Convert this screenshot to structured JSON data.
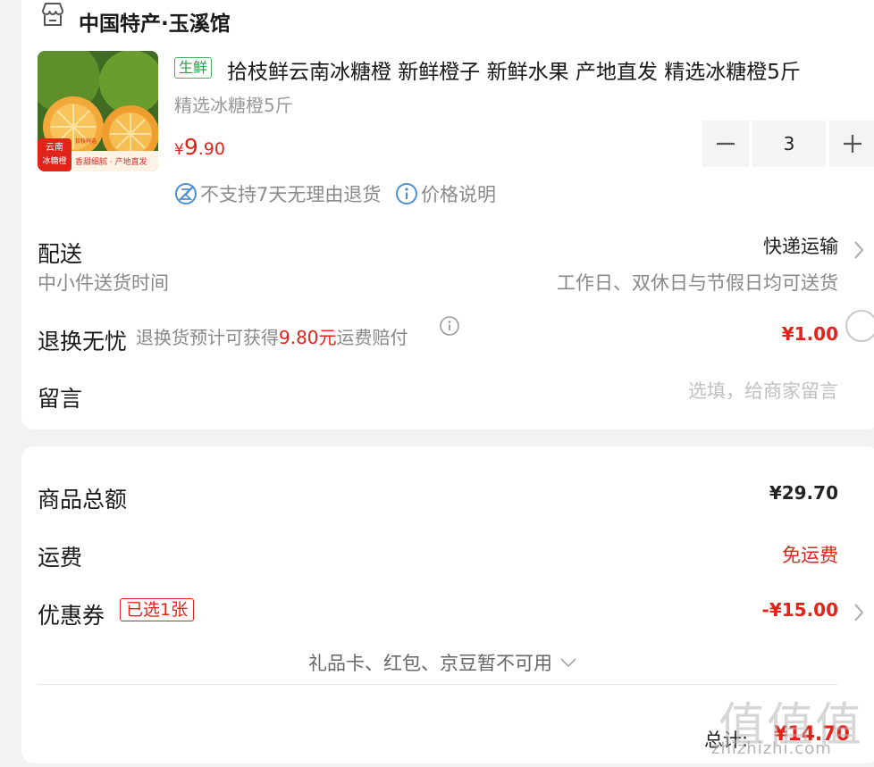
{
  "shop": {
    "name": "中国特产·玉溪馆",
    "icon": "shop-icon"
  },
  "product": {
    "tag": "生鲜",
    "title": "拾枝鲜云南冰糖橙 新鲜橙子 新鲜水果 产地直发 精选冰糖橙5斤",
    "spec": "精选冰糖橙5斤",
    "price_symbol": "¥",
    "price_int": "9",
    "price_dec": ".90",
    "quantity": "3",
    "image_badge_line1": "云南",
    "image_badge_line2": "冰糖橙",
    "image_caption": "香甜细腻 · 产地直发",
    "image_caption_small": "拾枝鲜选"
  },
  "policies": {
    "return": "不支持7天无理由退货",
    "price": "价格说明"
  },
  "delivery": {
    "label": "配送",
    "method": "快递运输",
    "sub_left": "中小件送货时间",
    "sub_right": "工作日、双休日与节假日均可送货"
  },
  "return_service": {
    "label": "退换无忧",
    "desc_prefix": "退换货预计可获得",
    "desc_amount": "9.80元",
    "desc_suffix": "运费赔付",
    "price": "¥1.00"
  },
  "message": {
    "label": "留言",
    "placeholder": "选填，给商家留言"
  },
  "summary": {
    "goods_label": "商品总额",
    "goods_value": "¥29.70",
    "shipping_label": "运费",
    "shipping_value": "免运费",
    "coupon_label": "优惠券",
    "coupon_badge": "已选1张",
    "coupon_value": "-¥15.00",
    "gift_line": "礼品卡、红包、京豆暂不可用",
    "total_label": "总计:",
    "total_value": "¥14.70"
  },
  "watermark": {
    "cn": "值值值",
    "en": "zhizhizhi.com"
  },
  "colors": {
    "accent": "#e2231a",
    "fresh": "#2e9c48",
    "muted": "#888888"
  }
}
